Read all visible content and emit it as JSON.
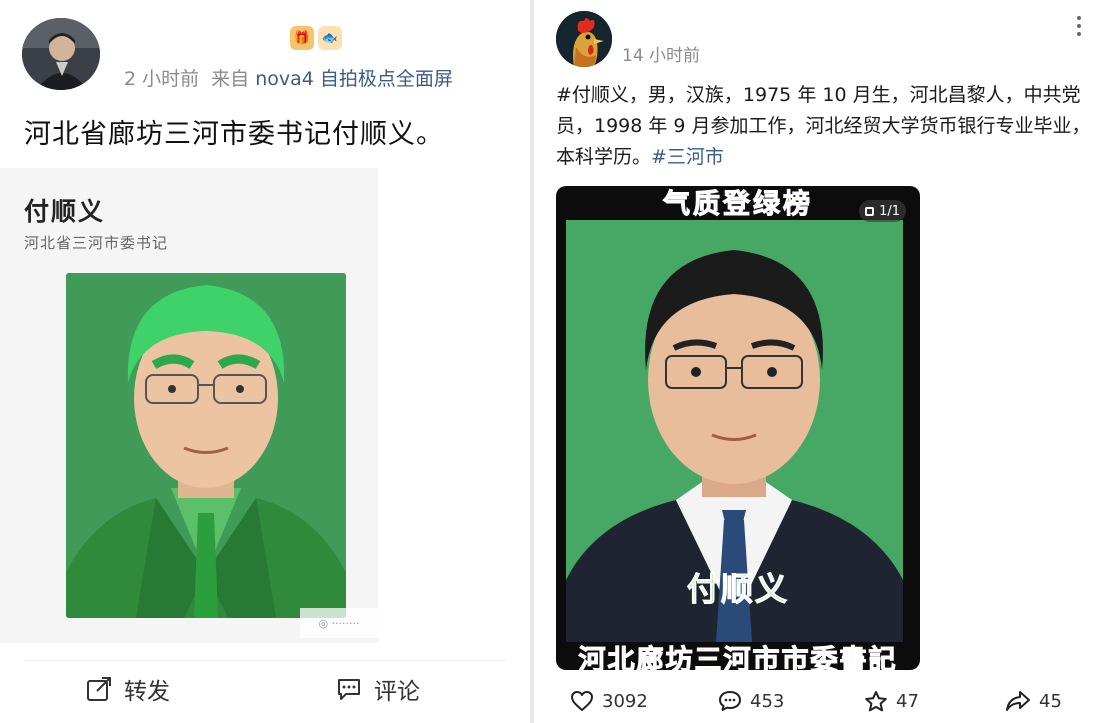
{
  "left_post": {
    "time": "2 小时前",
    "source_prefix": "来自",
    "source": "nova4 自拍极点全面屏",
    "text": "河北省廊坊三河市委书记付顺义。",
    "card": {
      "name": "付顺义",
      "title": "河北省三河市委书记"
    },
    "actions": {
      "repost": "转发",
      "comment": "评论"
    }
  },
  "right_post": {
    "time": "14 小时前",
    "text": "#付顺义，男，汉族，1975 年 10 月生，河北昌黎人，中共党员，1998 年 9 月参加工作，河北经贸大学货币银行专业毕业，本科学历。",
    "hashtag": "#三河市",
    "image": {
      "banner_top": "气质登绿榜",
      "counter": "1/1",
      "name_overlay": "付顺义",
      "banner_bottom": "河北廊坊三河市市委書記"
    },
    "stats": {
      "likes": "3092",
      "comments": "453",
      "favorites": "47",
      "shares": "45"
    }
  },
  "colors": {
    "link": "#3b5b8c",
    "meta": "#8b8b8b",
    "green_bg": "#3f9b57",
    "overlay_green": "#6bd36b"
  }
}
